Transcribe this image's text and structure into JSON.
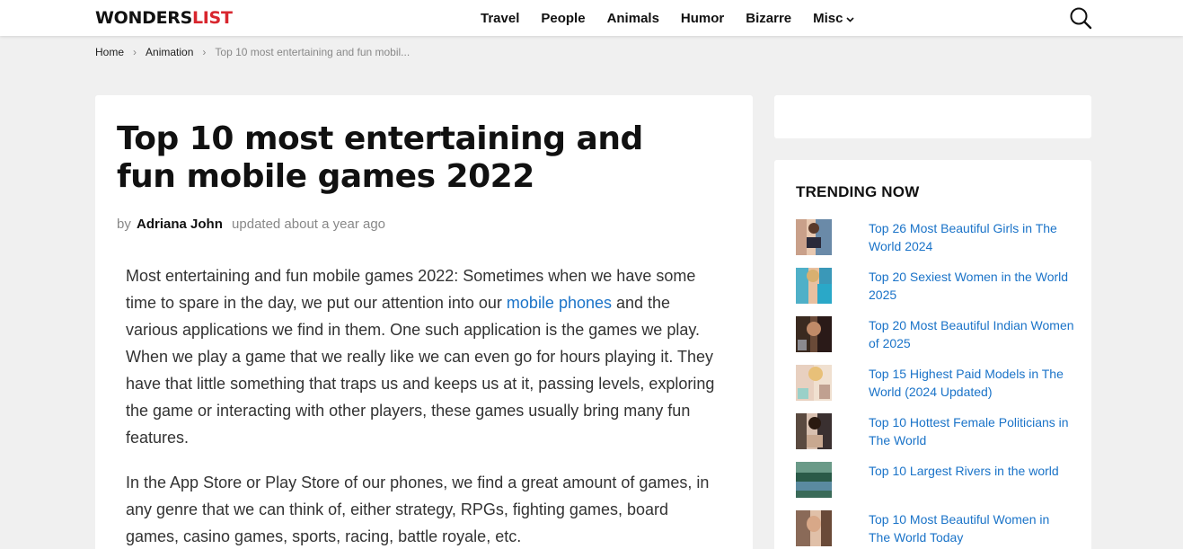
{
  "brand": {
    "part1": "WONDERS",
    "part2": "LIST"
  },
  "nav": {
    "items": [
      "Travel",
      "People",
      "Animals",
      "Humor",
      "Bizarre"
    ],
    "misc": "Misc"
  },
  "breadcrumb": {
    "home": "Home",
    "category": "Animation",
    "current": "Top 10 most entertaining and fun mobil..."
  },
  "article": {
    "title": "Top 10 most entertaining and fun mobile games 2022",
    "by": "by",
    "author": "Adriana John",
    "updated": "updated about a year ago",
    "p1_start": "Most entertaining and fun mobile games 2022: Sometimes when we have some time to spare in the day, we put our attention into our ",
    "p1_link": "mobile phones",
    "p1_end": " and the various applications we find in them. One such application is the games we play. When we play a game that we really like we can even go for hours playing it. They have that little something that traps us and keeps us at it, passing levels, exploring the game or interacting with other players, these games usually bring many fun features.",
    "p2": "In the App Store or Play Store of our phones, we find a great amount of games, in any genre that we can think of, either strategy, RPGs, fighting games, board games, casino games, sports, racing, battle royale, etc."
  },
  "sidebar": {
    "trending_title": "TRENDING NOW",
    "items": [
      {
        "label": "Top 26 Most Beautiful Girls in The World 2024"
      },
      {
        "label": "Top 20 Sexiest Women in the World 2025"
      },
      {
        "label": "Top 20 Most Beautiful Indian Women of 2025"
      },
      {
        "label": "Top 15 Highest Paid Models in The World (2024 Updated)"
      },
      {
        "label": "Top 10 Hottest Female Politicians in The World"
      },
      {
        "label": "Top 10 Largest Rivers in the world"
      },
      {
        "label": "Top 10 Most Beautiful Women in The World Today"
      }
    ]
  },
  "colors": {
    "accent_red": "#d8262e",
    "link_blue": "#1a73c8",
    "page_bg": "#f0f0f0"
  }
}
